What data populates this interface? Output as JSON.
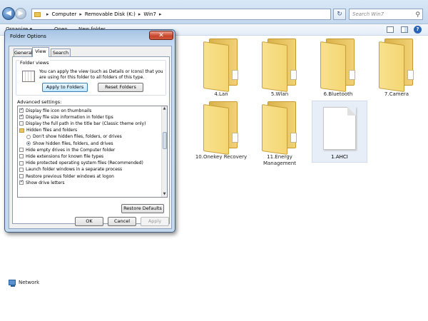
{
  "explorer": {
    "breadcrumb": [
      "Computer",
      "Removable Disk (K:)",
      "Win7"
    ],
    "search_placeholder": "Search Win7",
    "toolbar": {
      "organize": "Organize ▾",
      "open": "Open",
      "new_folder": "New folder"
    },
    "nav": {
      "network": "Network"
    },
    "items": [
      {
        "label": "4.Lan",
        "type": "folder"
      },
      {
        "label": "5.Wlan",
        "type": "folder"
      },
      {
        "label": "6.Bluetooth",
        "type": "folder"
      },
      {
        "label": "7.Camera",
        "type": "folder"
      },
      {
        "label": "10.Onekey Recovery",
        "type": "folder"
      },
      {
        "label": "11.Energy Management",
        "type": "folder"
      },
      {
        "label": "1.AHCI",
        "type": "file",
        "selected": true
      }
    ]
  },
  "dialog": {
    "title": "Folder Options",
    "tabs": [
      "General",
      "View",
      "Search"
    ],
    "active_tab": "View",
    "folder_views_label": "Folder views",
    "folder_views_desc": "You can apply the view (such as Details or Icons) that you are using for this folder to all folders of this type.",
    "apply_to_folders": "Apply to Folders",
    "reset_folders": "Reset Folders",
    "advanced_label": "Advanced settings:",
    "advanced": [
      {
        "kind": "checkbox",
        "checked": true,
        "label": "Display file icon on thumbnails",
        "indent": 0
      },
      {
        "kind": "checkbox",
        "checked": true,
        "label": "Display file size information in folder tips",
        "indent": 0
      },
      {
        "kind": "checkbox",
        "checked": false,
        "label": "Display the full path in the title bar (Classic theme only)",
        "indent": 0
      },
      {
        "kind": "folder",
        "checked": false,
        "label": "Hidden files and folders",
        "indent": 0
      },
      {
        "kind": "radio",
        "checked": false,
        "label": "Don't show hidden files, folders, or drives",
        "indent": 1
      },
      {
        "kind": "radio",
        "checked": true,
        "label": "Show hidden files, folders, and drives",
        "indent": 1
      },
      {
        "kind": "checkbox",
        "checked": false,
        "label": "Hide empty drives in the Computer folder",
        "indent": 0
      },
      {
        "kind": "checkbox",
        "checked": false,
        "label": "Hide extensions for known file types",
        "indent": 0
      },
      {
        "kind": "checkbox",
        "checked": false,
        "label": "Hide protected operating system files (Recommended)",
        "indent": 0
      },
      {
        "kind": "checkbox",
        "checked": false,
        "label": "Launch folder windows in a separate process",
        "indent": 0
      },
      {
        "kind": "checkbox",
        "checked": false,
        "label": "Restore previous folder windows at logon",
        "indent": 0
      },
      {
        "kind": "checkbox",
        "checked": true,
        "label": "Show drive letters",
        "indent": 0
      }
    ],
    "restore_defaults": "Restore Defaults",
    "ok": "OK",
    "cancel": "Cancel",
    "apply": "Apply"
  },
  "icons": {
    "back": "back-arrow-icon",
    "forward": "forward-arrow-icon",
    "refresh": "refresh-icon",
    "search": "search-icon",
    "help": "help-icon",
    "close": "close-icon"
  }
}
